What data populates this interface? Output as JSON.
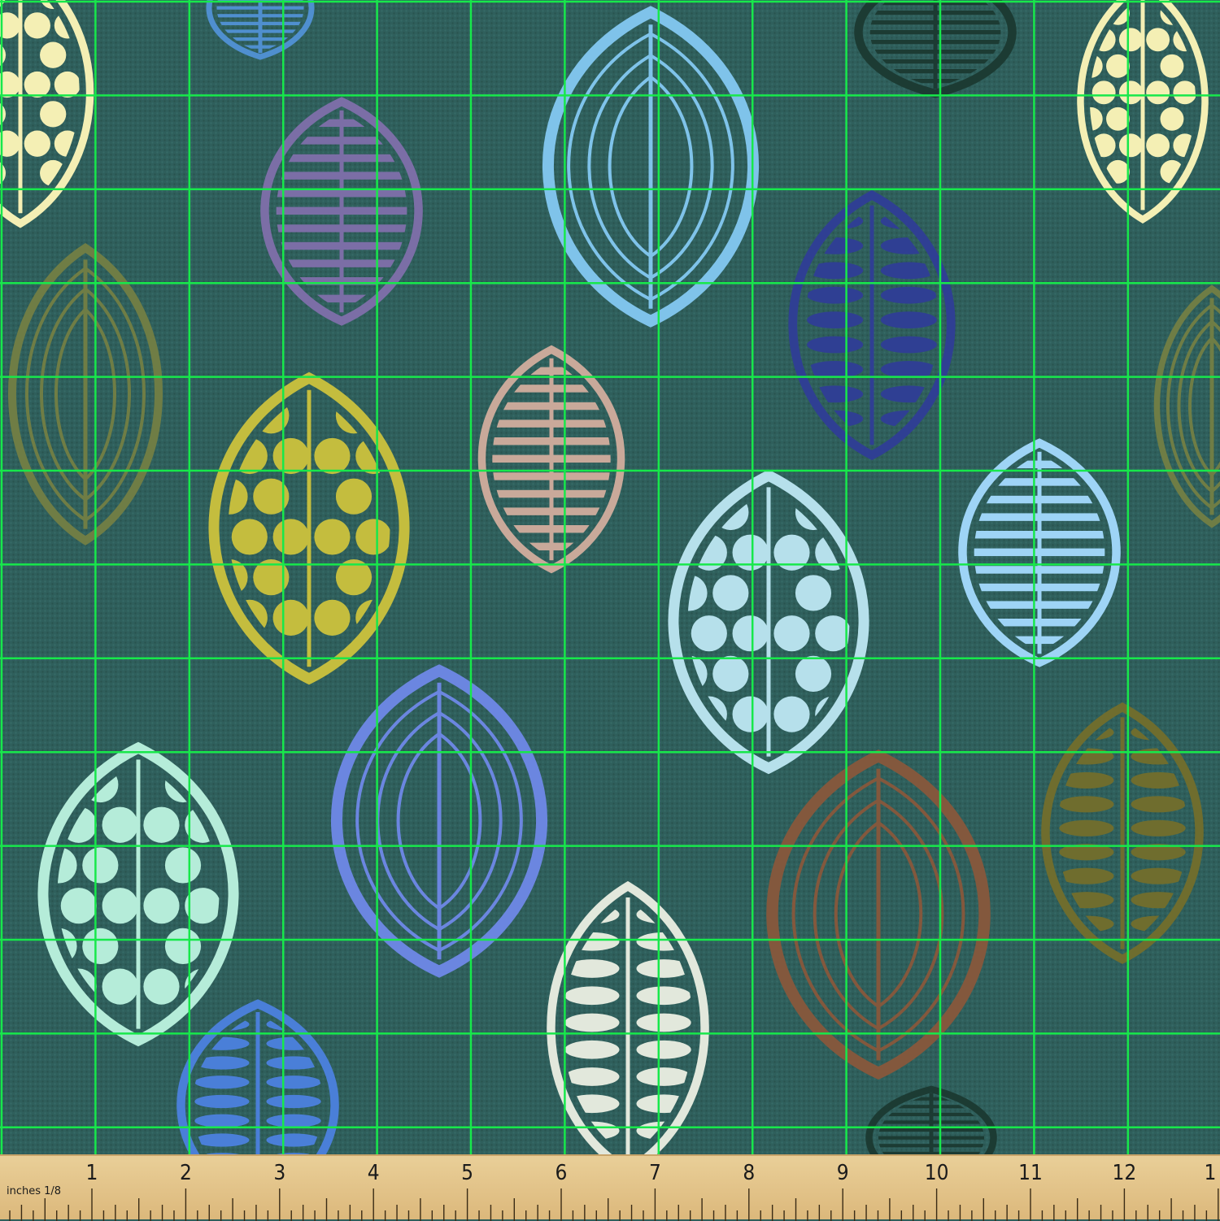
{
  "product": "fabric swatch with leaf pattern",
  "palette": {
    "background": "#2f5f5c",
    "grid": "#17e84b",
    "ruler": "#e3c48a"
  },
  "ruler": {
    "unit_label": "inches 1/8",
    "numbers": [
      "1",
      "2",
      "3",
      "4",
      "5",
      "6",
      "7",
      "8",
      "9",
      "10",
      "11",
      "12",
      "1"
    ]
  },
  "leaves": [
    {
      "style": "dots",
      "color": "#f4efb4"
    },
    {
      "style": "bars",
      "color": "#4f8fcf"
    },
    {
      "style": "bars",
      "color": "#7b6ea6"
    },
    {
      "style": "rings",
      "color": "#7fc3ea"
    },
    {
      "style": "bars",
      "color": "#1c3b33"
    },
    {
      "style": "dots",
      "color": "#f4efb4"
    },
    {
      "style": "rings",
      "color": "#6f7d45"
    },
    {
      "style": "dashes",
      "color": "#2f3f93"
    },
    {
      "style": "rings",
      "color": "#6f7d45"
    },
    {
      "style": "dots",
      "color": "#c4bd3e"
    },
    {
      "style": "bars",
      "color": "#c9a99a"
    },
    {
      "style": "dots",
      "color": "#b6e0eb"
    },
    {
      "style": "bars",
      "color": "#9ed4f6"
    },
    {
      "style": "dots",
      "color": "#b5ecd9"
    },
    {
      "style": "rings",
      "color": "#6b86e0"
    },
    {
      "style": "rings",
      "color": "#83583d"
    },
    {
      "style": "dashes",
      "color": "#6f6d2e"
    },
    {
      "style": "dashes",
      "color": "#e2e8dc"
    },
    {
      "style": "dashes",
      "color": "#4a7fd8"
    },
    {
      "style": "bars",
      "color": "#1c3b33"
    }
  ]
}
